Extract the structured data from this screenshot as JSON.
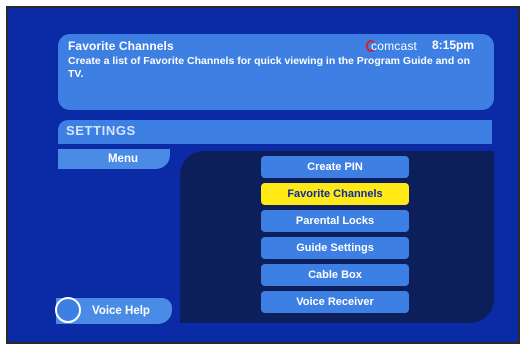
{
  "header": {
    "title": "Favorite Channels",
    "description": "Create a list of Favorite Channels for quick viewing in the Program Guide and on TV.",
    "brand": "comcast",
    "time": "8:15pm"
  },
  "section": {
    "label": "SETTINGS"
  },
  "menu_tab": {
    "label": "Menu"
  },
  "menu": {
    "items": [
      {
        "label": "Create PIN",
        "selected": false
      },
      {
        "label": "Favorite Channels",
        "selected": true
      },
      {
        "label": "Parental Locks",
        "selected": false
      },
      {
        "label": "Guide Settings",
        "selected": false
      },
      {
        "label": "Cable Box",
        "selected": false
      },
      {
        "label": "Voice Receiver",
        "selected": false
      }
    ]
  },
  "voice_help": {
    "label": "Voice Help"
  },
  "colors": {
    "background": "#0b2aa6",
    "panel": "#3d7fe2",
    "selection": "#ffea16",
    "dark_panel": "#0c1f5a",
    "brand_red": "#d4212c"
  }
}
